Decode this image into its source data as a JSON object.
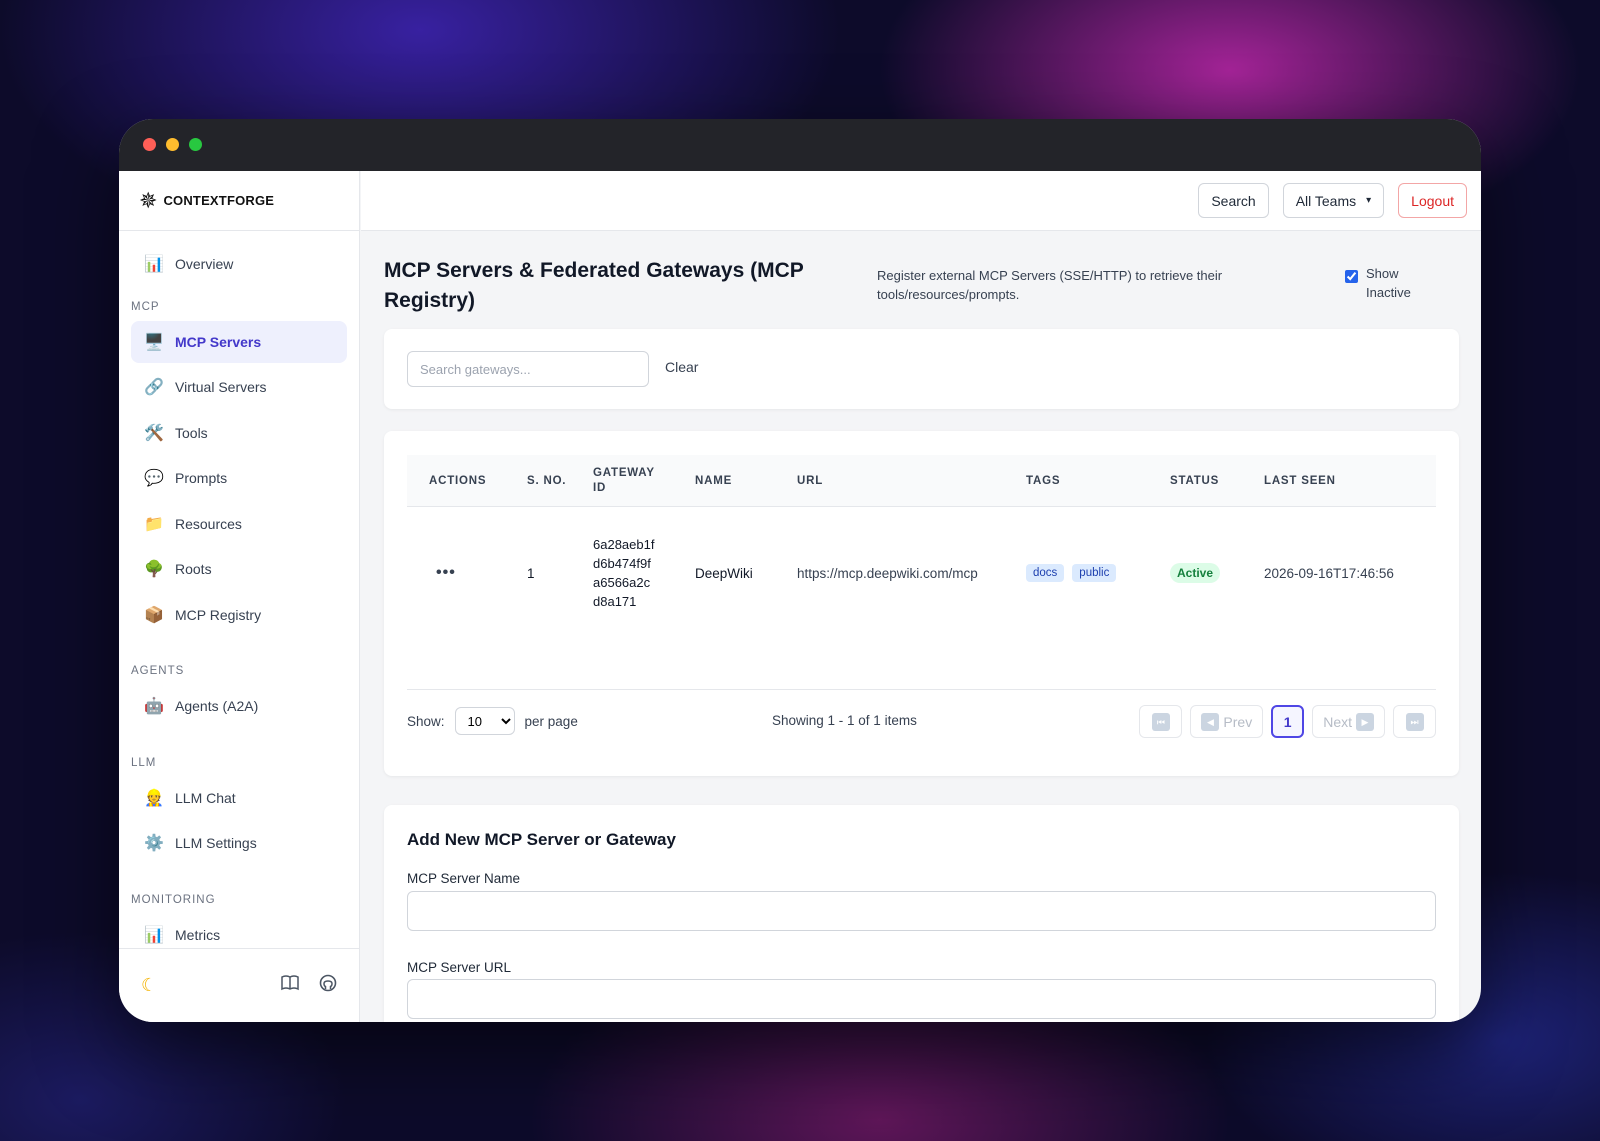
{
  "brand": {
    "name": "CONTEXTFORGE",
    "logo_icon": "forge-logo-icon"
  },
  "sidebar": {
    "top_items": [
      {
        "label": "Overview",
        "icon": "📊"
      }
    ],
    "sections": [
      {
        "title": "MCP",
        "items": [
          {
            "label": "MCP Servers",
            "icon": "🖥️",
            "active": true
          },
          {
            "label": "Virtual Servers",
            "icon": "🔗"
          },
          {
            "label": "Tools",
            "icon": "🛠️"
          },
          {
            "label": "Prompts",
            "icon": "💬"
          },
          {
            "label": "Resources",
            "icon": "📁"
          },
          {
            "label": "Roots",
            "icon": "🌳"
          },
          {
            "label": "MCP Registry",
            "icon": "📦"
          }
        ]
      },
      {
        "title": "AGENTS",
        "items": [
          {
            "label": "Agents (A2A)",
            "icon": "🤖"
          }
        ]
      },
      {
        "title": "LLM",
        "items": [
          {
            "label": "LLM Chat",
            "icon": "👷"
          },
          {
            "label": "LLM Settings",
            "icon": "⚙️"
          }
        ]
      },
      {
        "title": "MONITORING",
        "items": [
          {
            "label": "Metrics",
            "icon": "📊"
          }
        ]
      }
    ]
  },
  "topbar": {
    "search_label": "Search",
    "teams_label": "All Teams",
    "logout_label": "Logout"
  },
  "page": {
    "title": "MCP Servers & Federated Gateways (MCP Registry)",
    "description": "Register external MCP Servers (SSE/HTTP) to retrieve their tools/resources/prompts.",
    "show_inactive_label": "Show Inactive",
    "show_inactive_checked": true
  },
  "search": {
    "placeholder": "Search gateways...",
    "clear_label": "Clear"
  },
  "table": {
    "columns": [
      "ACTIONS",
      "S. NO.",
      "GATEWAY ID",
      "NAME",
      "URL",
      "TAGS",
      "STATUS",
      "LAST SEEN"
    ],
    "rows": [
      {
        "actions": "•••",
        "sno": "1",
        "gateway_id": "6a28aeb1fd6b474f9fa6566a2cd8a171",
        "name": "DeepWiki",
        "url": "https://mcp.deepwiki.com/mcp",
        "tags": [
          "docs",
          "public"
        ],
        "status": "Active",
        "last_seen": "2026-09-16T17:46:56"
      }
    ]
  },
  "pagination": {
    "show_label": "Show:",
    "per_page_value": "10",
    "per_page_label": "per page",
    "showing_text": "Showing 1 - 1 of 1 items",
    "prev_label": "Prev",
    "next_label": "Next",
    "current_page": "1"
  },
  "form": {
    "title": "Add New MCP Server or Gateway",
    "name_label": "MCP Server Name",
    "url_label": "MCP Server URL"
  },
  "colors": {
    "accent": "#4f46e5",
    "logout": "#dc2626",
    "active_status": "#15803d",
    "tag_bg": "#dbeafe"
  }
}
